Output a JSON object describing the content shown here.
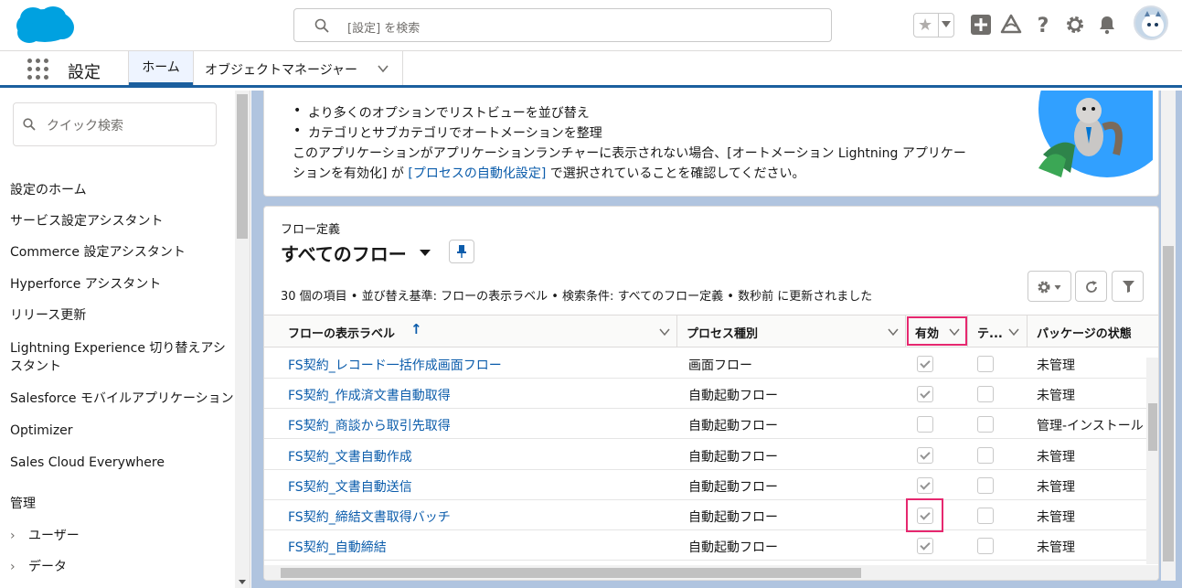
{
  "header": {
    "search_placeholder": "[設定] を検索"
  },
  "nav": {
    "app_name": "設定",
    "tab_home": "ホーム",
    "tab_object_manager": "オブジェクトマネージャー"
  },
  "sidebar": {
    "quick_find_placeholder": "クイック検索",
    "items": [
      "設定のホーム",
      "サービス設定アシスタント",
      "Commerce 設定アシスタント",
      "Hyperforce アシスタント",
      "リリース更新",
      "Lightning Experience 切り替えアシスタント",
      "Salesforce モバイルアプリケーション",
      "Optimizer",
      "Sales Cloud Everywhere"
    ],
    "section_admin": "管理",
    "expandable": [
      "ユーザー",
      "データ"
    ]
  },
  "info_card": {
    "bullet1": "より多くのオプションでリストビューを並び替え",
    "bullet2": "カテゴリとサブカテゴリでオートメーションを整理",
    "para_part1": "このアプリケーションがアプリケーションランチャーに表示されない場合、[オートメーション Lightning アプリケーションを有効化] が ",
    "para_link": "[プロセスの自動化設定]",
    "para_part2": " で選択されていることを確認してください。"
  },
  "list_view": {
    "object_label": "フロー定義",
    "title": "すべてのフロー",
    "status": "30 個の項目 • 並び替え基準: フローの表示ラベル • 検索条件: すべてのフロー定義 • 数秒前 に更新されました",
    "columns": {
      "label": "フローの表示ラベル",
      "process_type": "プロセス種別",
      "active": "有効",
      "template": "テ...",
      "package_state": "パッケージの状態"
    },
    "rows": [
      {
        "label": "FS契約_レコード一括作成画面フロー",
        "type": "画面フロー",
        "active": true,
        "template": false,
        "package": "未管理"
      },
      {
        "label": "FS契約_作成済文書自動取得",
        "type": "自動起動フロー",
        "active": true,
        "template": false,
        "package": "未管理"
      },
      {
        "label": "FS契約_商談から取引先取得",
        "type": "自動起動フロー",
        "active": false,
        "template": false,
        "package": "管理-インストール"
      },
      {
        "label": "FS契約_文書自動作成",
        "type": "自動起動フロー",
        "active": true,
        "template": false,
        "package": "未管理"
      },
      {
        "label": "FS契約_文書自動送信",
        "type": "自動起動フロー",
        "active": true,
        "template": false,
        "package": "未管理"
      },
      {
        "label": "FS契約_締結文書取得バッチ",
        "type": "自動起動フロー",
        "active": true,
        "template": false,
        "package": "未管理"
      },
      {
        "label": "FS契約_自動締結",
        "type": "自動起動フロー",
        "active": true,
        "template": false,
        "package": "未管理"
      }
    ]
  },
  "colors": {
    "brand_blue": "#1b5f9e",
    "link": "#0b5cab",
    "highlight": "#e6286f",
    "background": "#b0c4df"
  }
}
